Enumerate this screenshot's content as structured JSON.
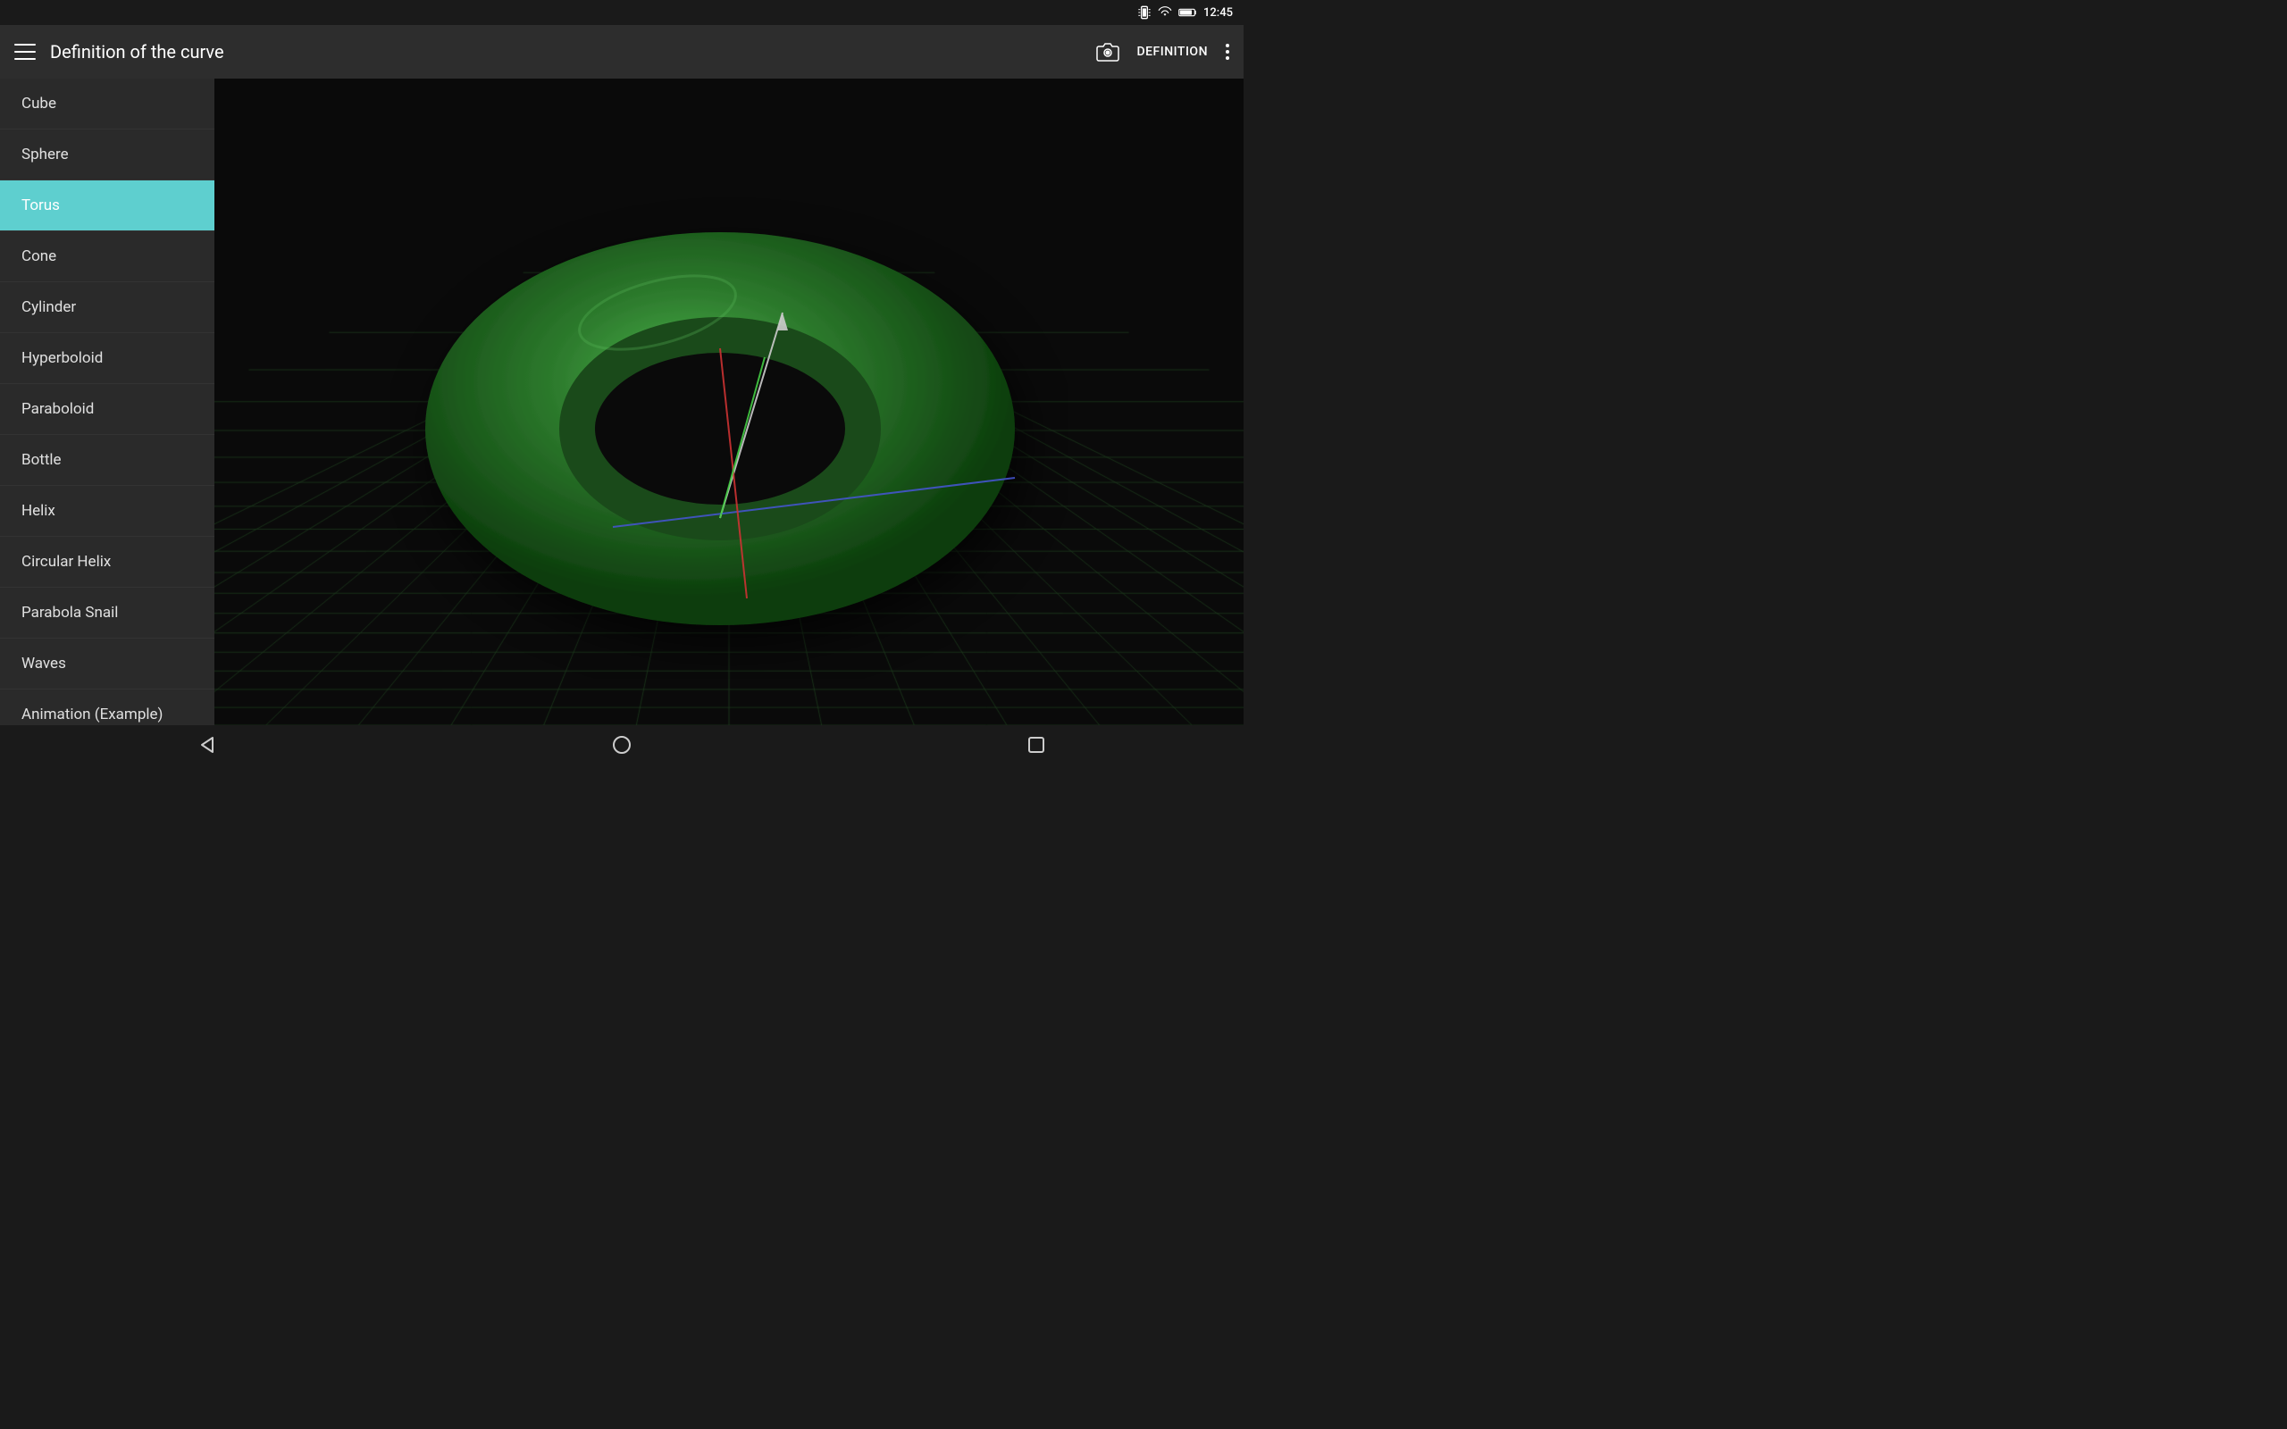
{
  "statusBar": {
    "time": "12:45"
  },
  "appBar": {
    "title": "Definition of the curve",
    "definitionLabel": "DEFINITION"
  },
  "sidebar": {
    "items": [
      {
        "id": "cube",
        "label": "Cube",
        "active": false
      },
      {
        "id": "sphere",
        "label": "Sphere",
        "active": false
      },
      {
        "id": "torus",
        "label": "Torus",
        "active": true
      },
      {
        "id": "cone",
        "label": "Cone",
        "active": false
      },
      {
        "id": "cylinder",
        "label": "Cylinder",
        "active": false
      },
      {
        "id": "hyperboloid",
        "label": "Hyperboloid",
        "active": false
      },
      {
        "id": "paraboloid",
        "label": "Paraboloid",
        "active": false
      },
      {
        "id": "bottle",
        "label": "Bottle",
        "active": false
      },
      {
        "id": "helix",
        "label": "Helix",
        "active": false
      },
      {
        "id": "circular-helix",
        "label": "Circular Helix",
        "active": false
      },
      {
        "id": "parabola-snail",
        "label": "Parabola Snail",
        "active": false
      },
      {
        "id": "waves",
        "label": "Waves",
        "active": false
      },
      {
        "id": "animation-example",
        "label": "Animation (Example)",
        "active": false
      }
    ]
  },
  "navBar": {
    "backLabel": "back",
    "homeLabel": "home",
    "recentsLabel": "recents"
  },
  "colors": {
    "activeItemBg": "#5ecfcf",
    "torusGreen": "#2d7a2d",
    "gridColor": "#1a3a1a"
  }
}
